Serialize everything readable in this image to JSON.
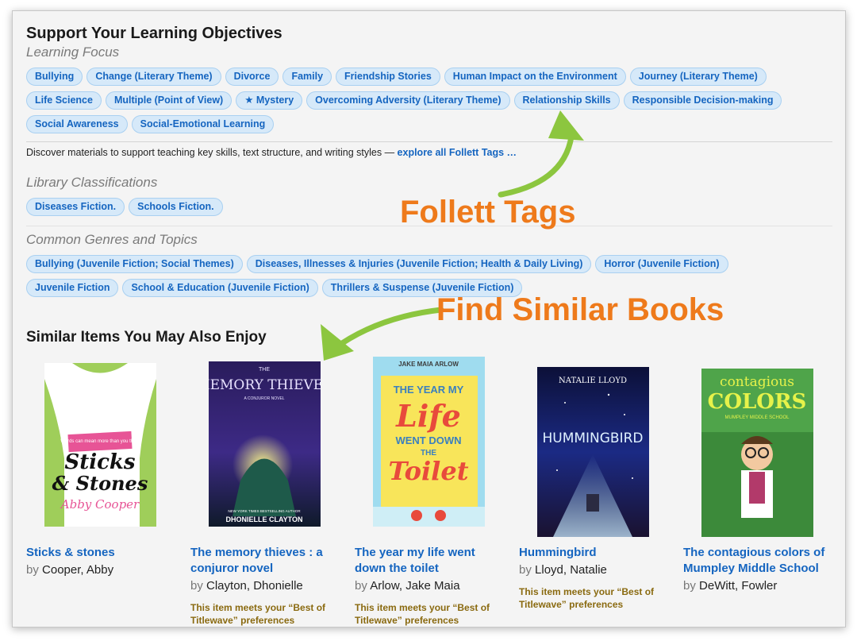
{
  "learning": {
    "title": "Support Your Learning Objectives",
    "focus_label": "Learning Focus",
    "focus_tags": [
      "Bullying",
      "Change (Literary Theme)",
      "Divorce",
      "Family",
      "Friendship Stories",
      "Human Impact on the Environment",
      "Journey (Literary Theme)",
      "Life Science",
      "Multiple (Point of View)",
      "★ Mystery",
      "Overcoming Adversity (Literary Theme)",
      "Relationship Skills",
      "Responsible Decision-making",
      "Social Awareness",
      "Social-Emotional Learning"
    ],
    "discover_text": "Discover materials to support teaching key skills, text structure, and writing styles —",
    "explore_link": "explore all Follett Tags …"
  },
  "library": {
    "label": "Library Classifications",
    "tags": [
      "Diseases Fiction.",
      "Schools Fiction."
    ]
  },
  "genres": {
    "label": "Common Genres and Topics",
    "tags": [
      "Bullying (Juvenile Fiction; Social Themes)",
      "Diseases, Illnesses & Injuries (Juvenile Fiction; Health & Daily Living)",
      "Horror (Juvenile Fiction)",
      "Juvenile Fiction",
      "School & Education (Juvenile Fiction)",
      "Thrillers & Suspense (Juvenile Fiction)"
    ]
  },
  "annotations": {
    "follett_tags": "Follett Tags",
    "find_similar": "Find Similar Books",
    "color": "#ee7a1b",
    "arrow_color": "#8cc63f"
  },
  "similar": {
    "title": "Similar Items You May Also Enjoy",
    "by_label": "by",
    "books": [
      {
        "title": "Sticks & stones",
        "author": "Cooper, Abby",
        "best": "",
        "cover": {
          "line1": "Sticks",
          "line2": "& Stones",
          "author": "Abby Cooper",
          "tagline": "Words can mean more than you think"
        }
      },
      {
        "title": "The memory thieves : a conjuror novel",
        "author": "Clayton, Dhonielle",
        "best": "This item meets your “Best of Titlewave” preferences",
        "cover": {
          "line1": "THE",
          "line2": "MEMORY THIEVES",
          "sub": "A CONJUROR NOVEL",
          "top": "NEW YORK TIMES BESTSELLING AUTHOR",
          "author": "DHONIELLE CLAYTON"
        }
      },
      {
        "title": "The year my life went down the toilet",
        "author": "Arlow, Jake Maia",
        "best": "This item meets your “Best of Titlewave” preferences",
        "cover": {
          "author": "JAKE MAIA ARLOW",
          "line1": "THE YEAR MY",
          "line2": "Life",
          "line3": "WENT DOWN",
          "line4": "THE",
          "line5": "Toilet"
        }
      },
      {
        "title": "Hummingbird",
        "author": "Lloyd, Natalie",
        "best": "This item meets your “Best of Titlewave” preferences",
        "cover": {
          "author": "NATALIE LLOYD",
          "line1": "HUMMINGBIRD"
        }
      },
      {
        "title": "The contagious colors of Mumpley Middle School",
        "author": "DeWitt, Fowler",
        "best": "",
        "cover": {
          "line1": "contagious",
          "line2": "COLORS",
          "line3": "MUMPLEY MIDDLE SCHOOL"
        }
      }
    ]
  }
}
